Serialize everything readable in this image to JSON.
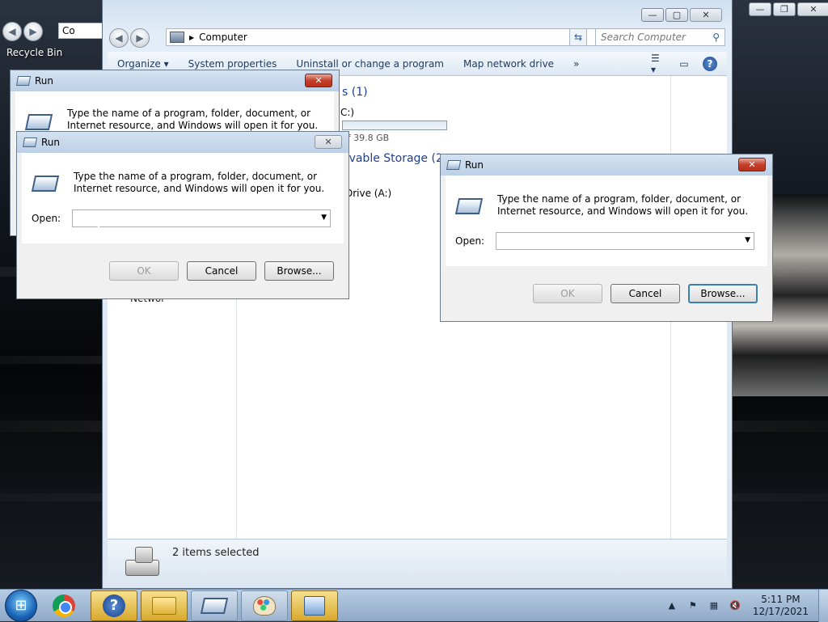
{
  "desktop": {
    "recycle_bin_label": "Recycle Bin",
    "back_address_text": "Co"
  },
  "explorer": {
    "address_path": "Computer",
    "search_placeholder": "Search Computer",
    "toolbar": {
      "organize": "Organize ▾",
      "system_properties": "System properties",
      "uninstall": "Uninstall or change a program",
      "map_network": "Map network drive",
      "more": "»"
    },
    "hdd_group": "s (1)",
    "drive_c_label": "C:)",
    "drive_c_used_fraction": 0.0,
    "drive_c_free_text": "of 39.8 GB",
    "removable_group": "ovable Storage (2",
    "drive_a_label": "Drive (A:)",
    "nav_network_label": "Networ",
    "status_text": "2 items selected"
  },
  "run_dialogs": [
    {
      "title": "Run",
      "description": "Type the name of a program, folder, document, or Internet resource, and Windows will open it for you."
    },
    {
      "title": "Run",
      "description": "Type the name of a program, folder, document, or Internet resource, and Windows will open it for you.",
      "open_label": "Open:",
      "open_value": "",
      "ok_label": "OK",
      "cancel_label": "Cancel",
      "browse_label": "Browse..."
    },
    {
      "title": "Run",
      "description": "Type the name of a program, folder, document, or Internet resource, and Windows will open it for you.",
      "open_label": "Open:",
      "open_value": "",
      "ok_label": "OK",
      "cancel_label": "Cancel",
      "browse_label": "Browse..."
    }
  ],
  "taskbar": {
    "pinned": [
      "start-orb",
      "chrome-icon",
      "help-icon",
      "file-explorer-icon",
      "run-icon",
      "paint-icon",
      "control-panel-icon"
    ],
    "clock_time": "5:11 PM",
    "clock_date": "12/17/2021"
  },
  "colors": {
    "accent": "#1e3f91",
    "close_red": "#c4402b",
    "taskbar_active": "#d9a82c"
  }
}
